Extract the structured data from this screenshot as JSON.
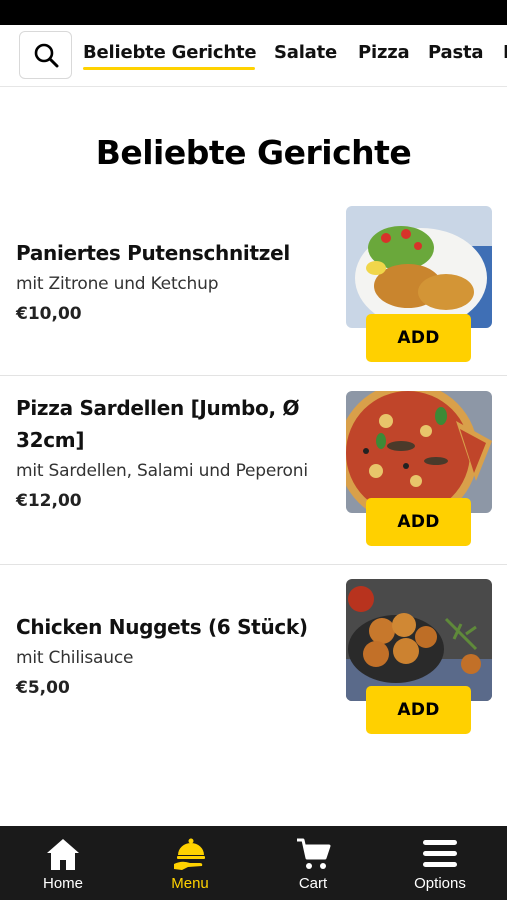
{
  "categories": {
    "search_icon": "search-icon",
    "tabs": [
      {
        "label": "Beliebte Gerichte",
        "active": true
      },
      {
        "label": "Salate"
      },
      {
        "label": "Pizza"
      },
      {
        "label": "Pasta"
      },
      {
        "label": "P"
      }
    ]
  },
  "section_title": "Beliebte Gerichte",
  "items": [
    {
      "name": "Paniertes Putenschnitzel",
      "description": "mit Zitrone und Ketchup",
      "price": "€10,00",
      "add_label": "ADD"
    },
    {
      "name": "Pizza Sardellen [Jumbo, Ø 32cm]",
      "description": "mit Sardellen, Salami und Peperoni",
      "price": "€12,00",
      "add_label": "ADD"
    },
    {
      "name": "Chicken Nuggets (6 Stück)",
      "description": "mit Chilisauce",
      "price": "€5,00",
      "add_label": "ADD"
    }
  ],
  "bottom_nav": [
    {
      "label": "Home",
      "icon": "home-icon"
    },
    {
      "label": "Menu",
      "icon": "menu-cloche-icon",
      "active": true
    },
    {
      "label": "Cart",
      "icon": "cart-icon"
    },
    {
      "label": "Options",
      "icon": "hamburger-icon"
    }
  ],
  "colors": {
    "accent": "#ffd200",
    "nav_background": "#1a1a1a"
  }
}
